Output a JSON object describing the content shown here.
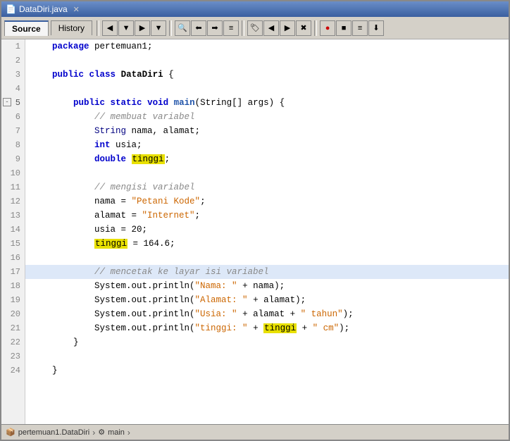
{
  "window": {
    "title": "DataDiri.java",
    "tabs": [
      {
        "label": "Source",
        "active": true
      },
      {
        "label": "History",
        "active": false
      }
    ]
  },
  "statusbar": {
    "breadcrumb": [
      "pertemuan1.DataDiri",
      "main"
    ]
  },
  "code": {
    "lines": [
      {
        "n": 1,
        "content": "    package pertemuan1;",
        "type": "plain"
      },
      {
        "n": 2,
        "content": "",
        "type": "plain"
      },
      {
        "n": 3,
        "content": "    public class DataDiri {",
        "type": "plain"
      },
      {
        "n": 4,
        "content": "",
        "type": "plain"
      },
      {
        "n": 5,
        "content": "        public static void main(String[] args) {",
        "type": "main",
        "collapse": true
      },
      {
        "n": 6,
        "content": "            // membuat variabel",
        "type": "comment"
      },
      {
        "n": 7,
        "content": "            String nama, alamat;",
        "type": "plain"
      },
      {
        "n": 8,
        "content": "            int usia;",
        "type": "plain"
      },
      {
        "n": 9,
        "content": "            double tinggi;",
        "type": "highlight-tinggi"
      },
      {
        "n": 10,
        "content": "",
        "type": "plain"
      },
      {
        "n": 11,
        "content": "            // mengisi variabel",
        "type": "comment"
      },
      {
        "n": 12,
        "content": "            nama = \"Petani Kode\";",
        "type": "string-line"
      },
      {
        "n": 13,
        "content": "            alamat = \"Internet\";",
        "type": "string-line"
      },
      {
        "n": 14,
        "content": "            usia = 20;",
        "type": "plain"
      },
      {
        "n": 15,
        "content": "            tinggi = 164.6;",
        "type": "highlight-tinggi2"
      },
      {
        "n": 16,
        "content": "",
        "type": "plain"
      },
      {
        "n": 17,
        "content": "            // mencetak ke layar isi variabel",
        "type": "comment-hl"
      },
      {
        "n": 18,
        "content": "            System.out.println(\"Nama: \" + nama);",
        "type": "print"
      },
      {
        "n": 19,
        "content": "            System.out.println(\"Alamat: \" + alamat);",
        "type": "print"
      },
      {
        "n": 20,
        "content": "            System.out.println(\"Usia: \" + alamat + \" tahun\");",
        "type": "print"
      },
      {
        "n": 21,
        "content": "            System.out.println(\"tinggi: \" + tinggi + \" cm\");",
        "type": "print-hl"
      },
      {
        "n": 22,
        "content": "        }",
        "type": "plain"
      },
      {
        "n": 23,
        "content": "",
        "type": "plain"
      },
      {
        "n": 24,
        "content": "    }",
        "type": "plain"
      }
    ]
  }
}
